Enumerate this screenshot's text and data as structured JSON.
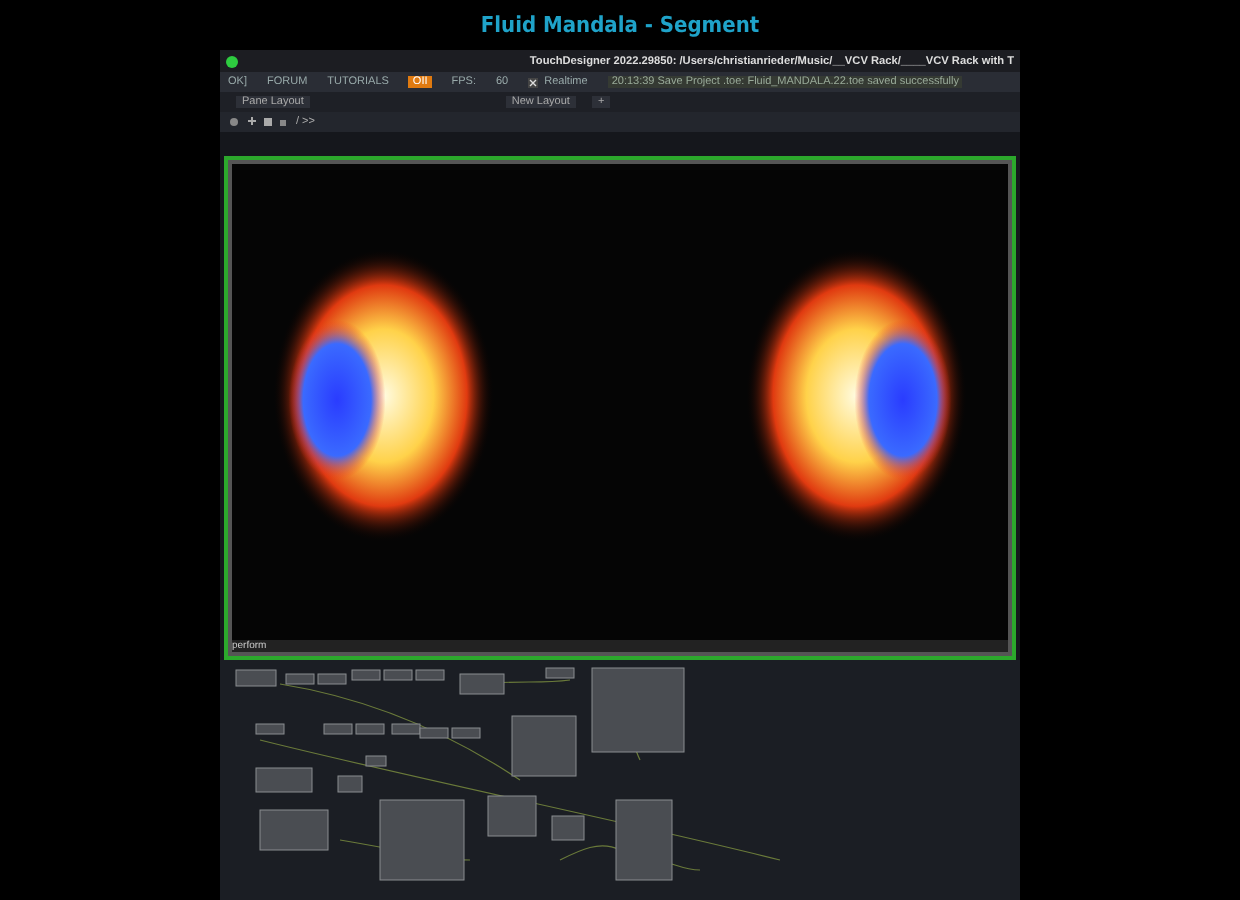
{
  "video_title": "Fluid Mandala - Segment",
  "window": {
    "title": "TouchDesigner 2022.29850: /Users/christianrieder/Music/__VCV Rack/____VCV Rack with T"
  },
  "toolbar": {
    "items": [
      {
        "label": "OK]",
        "kind": "plain"
      },
      {
        "label": "FORUM",
        "kind": "plain"
      },
      {
        "label": "TUTORIALS",
        "kind": "plain"
      },
      {
        "label": "OII",
        "kind": "badge"
      },
      {
        "label": "FPS:",
        "kind": "plain"
      },
      {
        "label": "60",
        "kind": "plain"
      }
    ],
    "realtime": {
      "label": "Realtime",
      "checked": true
    },
    "message": "20:13:39 Save Project .toe: Fluid_MANDALA.22.toe saved successfully"
  },
  "layout_bar": {
    "pane_layout": "Pane Layout",
    "new_layout": "New Layout",
    "add": "+"
  },
  "path_bar": {
    "path": "/ >>"
  },
  "viewer": {
    "label": "perform"
  }
}
